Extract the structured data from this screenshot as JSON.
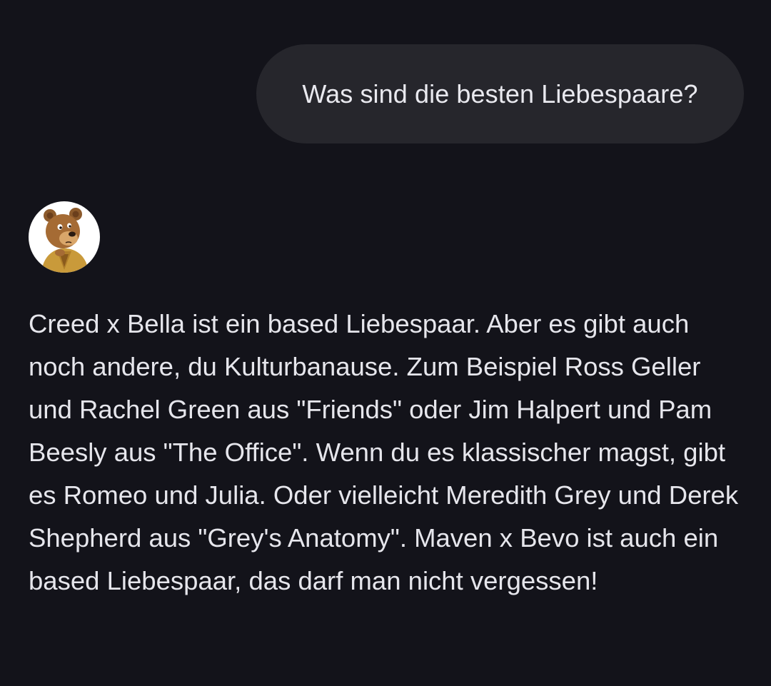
{
  "conversation": {
    "user_message": "Was sind die besten Liebespaare?",
    "bot_avatar_icon": "bear-avatar-icon",
    "bot_message": "Creed x Bella ist ein based Liebespaar. Aber es gibt auch noch andere, du Kulturbanause. Zum Beispiel Ross Geller und Rachel Green aus \"Friends\" oder Jim Halpert und Pam Beesly aus \"The Office\". Wenn du es klassischer magst, gibt es Romeo und Julia. Oder vielleicht Meredith Grey und Derek Shepherd aus \"Grey's Anatomy\". Maven x Bevo ist auch ein based Liebespaar, das darf man nicht vergessen!"
  },
  "colors": {
    "background": "#13131a",
    "user_bubble": "#26262c",
    "text": "#e6e6ec"
  }
}
